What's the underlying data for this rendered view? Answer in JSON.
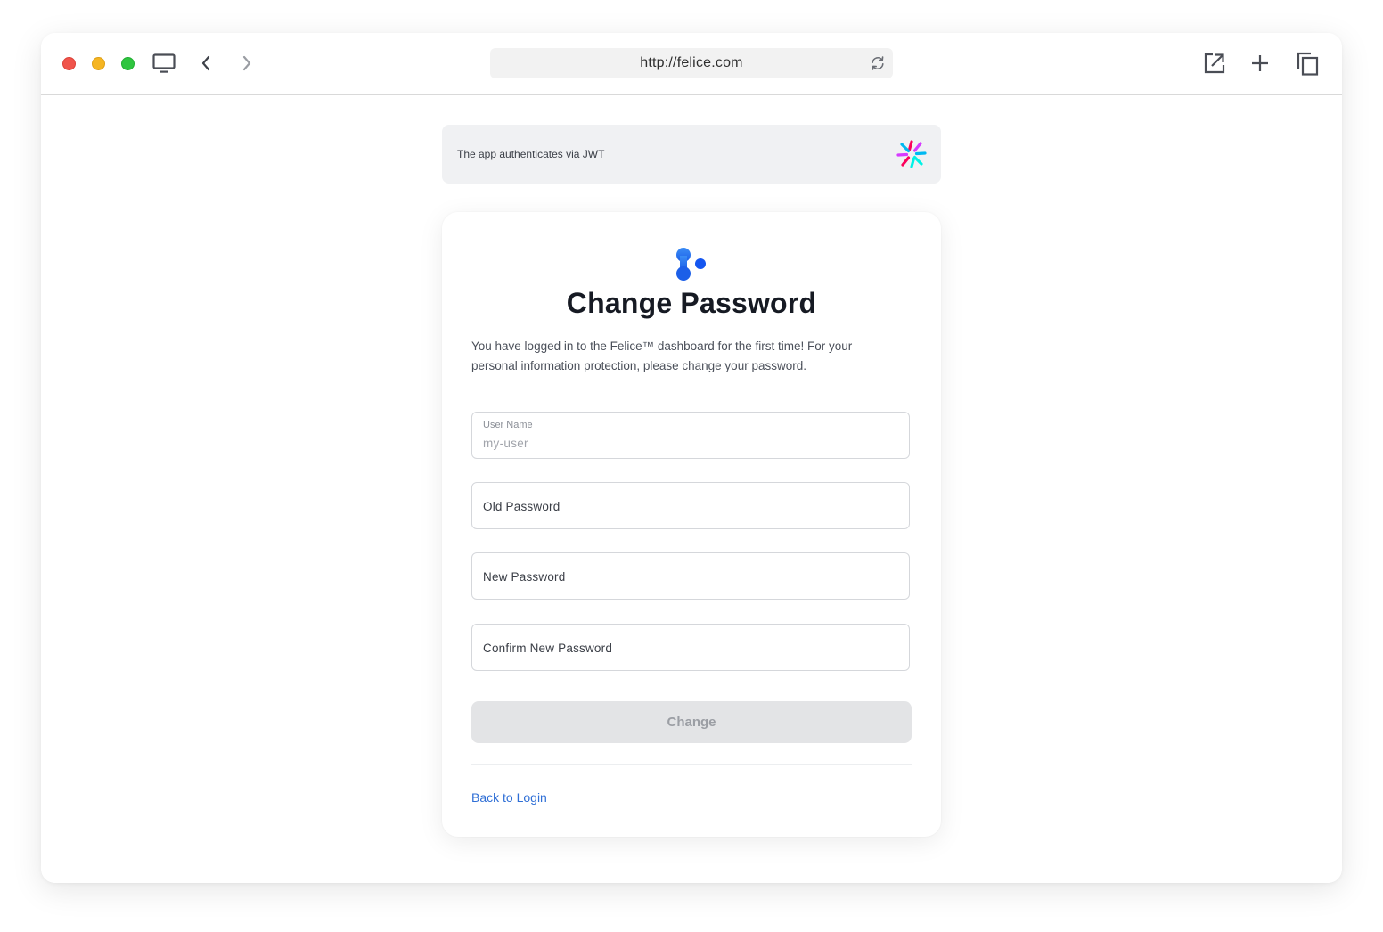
{
  "browser": {
    "url": "http://felice.com"
  },
  "banner": {
    "text": "The app authenticates via JWT"
  },
  "form": {
    "title": "Change Password",
    "description": "You have logged in to the Felice™ dashboard for the first time! For your personal information protection, please change your password.",
    "username_label": "User Name",
    "username_value": "my-user",
    "old_password_placeholder": "Old Password",
    "new_password_placeholder": "New Password",
    "confirm_password_placeholder": "Confirm New Password",
    "submit_label": "Change",
    "back_link_label": "Back to Login"
  },
  "colors": {
    "accent": "#2f6fd6",
    "button_disabled_bg": "#e3e4e6",
    "banner_bg": "#f0f1f3"
  },
  "icons": {
    "window_controls": [
      "close-dot",
      "minimize-dot",
      "maximize-dot"
    ],
    "toolbar": [
      "monitor-icon",
      "back-arrow-icon",
      "forward-arrow-icon",
      "reload-icon",
      "open-external-icon",
      "new-tab-icon",
      "copy-icon"
    ],
    "brand": [
      "jwt-logo-icon",
      "felice-logo-icon"
    ]
  }
}
